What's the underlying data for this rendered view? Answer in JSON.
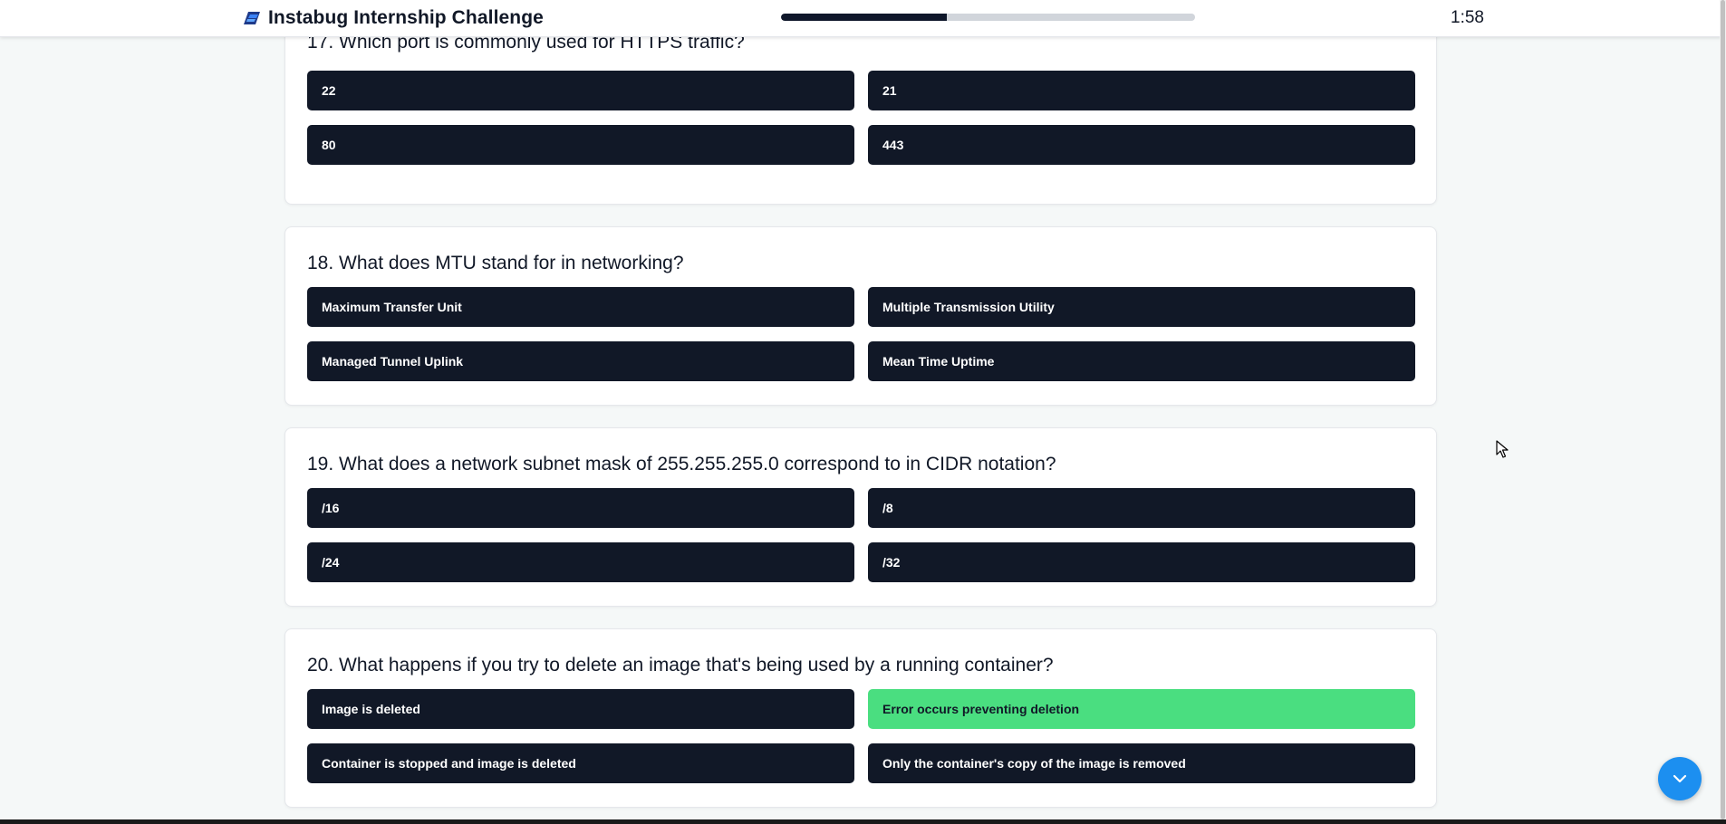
{
  "header": {
    "title": "Instabug Internship Challenge",
    "logo_icon": "instabug-logo-icon",
    "timer": "1:58",
    "progress_fraction": 0.4
  },
  "colors": {
    "option_bg": "#111827",
    "option_text": "#ffffff",
    "selected_bg": "#4ade80",
    "progress_fill": "#0f172a",
    "progress_track": "#d1d5db",
    "fab_bg": "#1c8ff0"
  },
  "questions": [
    {
      "title": "17. Which port is commonly used for HTTPS traffic?",
      "options": [
        "22",
        "21",
        "80",
        "443"
      ],
      "selected_index": null
    },
    {
      "title": "18. What does MTU stand for in networking?",
      "options": [
        "Maximum Transfer Unit",
        "Multiple Transmission Utility",
        "Managed Tunnel Uplink",
        "Mean Time Uptime"
      ],
      "selected_index": null
    },
    {
      "title": "19. What does a network subnet mask of 255.255.255.0 correspond to in CIDR notation?",
      "options": [
        "/16",
        "/8",
        "/24",
        "/32"
      ],
      "selected_index": null
    },
    {
      "title": "20. What happens if you try to delete an image that's being used by a running container?",
      "options": [
        "Image is deleted",
        "Error occurs preventing deletion",
        "Container is stopped and image is deleted",
        "Only the container's copy of the image is removed"
      ],
      "selected_index": 1
    }
  ],
  "scroll_button": {
    "icon": "chevron-down-icon"
  }
}
